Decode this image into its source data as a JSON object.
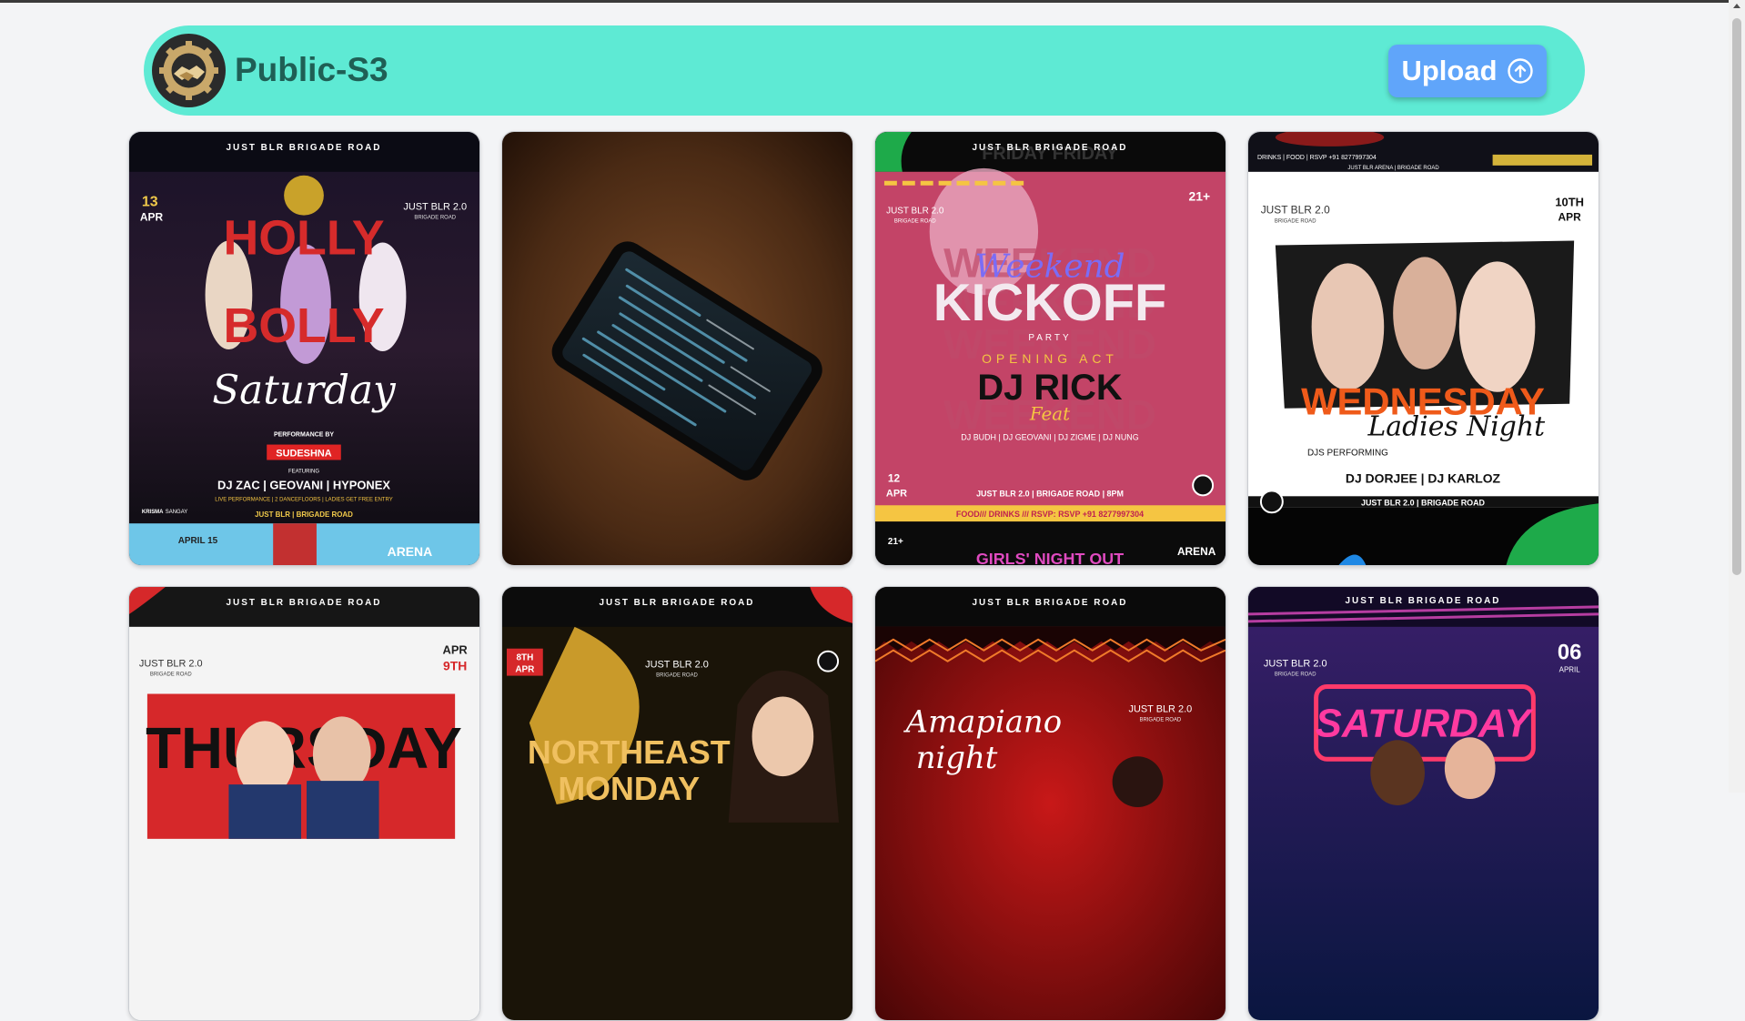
{
  "app": {
    "title": "Public-S3",
    "upload_label": "Upload"
  },
  "colors": {
    "header_bg": "#5eead4",
    "title": "#1f5f55",
    "upload_bg": "#60a5fa",
    "page_bg": "#f3f4f6"
  },
  "posters": [
    {
      "top": "JUST BLR BRIGADE ROAD",
      "date_day": "13",
      "date_month": "APR",
      "brand": "JUST BLR 2.0",
      "brand_sub": "BRIGADE ROAD",
      "line1": "HOLLY",
      "line2": "BOLLY",
      "script": "Saturday",
      "perf_by": "PERFORMANCE BY",
      "performer": "SUDESHNA",
      "featuring": "FEATURING",
      "djs": "DJ ZAC | GEOVANI | HYPONEX",
      "info": "LIVE PERFORMANCE | 2 DANCEFLOORS | LADIES GET FREE ENTRY",
      "footer": "JUST BLR | BRIGADE ROAD",
      "strip_a": "APRIL 15",
      "strip_b": "ARENA",
      "tag_left_a": "KRISMA",
      "tag_left_b": "SANGAY"
    },
    {
      "description": "phone-photo"
    },
    {
      "top": "JUST BLR BRIGADE ROAD",
      "top_bg": "FRIDAY FRIDAY",
      "brand": "JUST BLR 2.0",
      "brand_sub": "BRIGADE ROAD",
      "age": "21+",
      "script": "Weekend",
      "kick": "KICKOFF",
      "party": "PARTY",
      "opening": "OPENING ACT",
      "dj": "DJ RICK",
      "feat": "Feat",
      "djs": "DJ BUDH | DJ GEOVANI | DJ ZIGME | DJ NUNG",
      "date_day": "12",
      "date_month": "APR",
      "venue": "JUST BLR 2.0 | BRIGADE ROAD | 8PM",
      "rsvp": "FOOD/// DRINKS /// RSVP: RSVP +91 8277997304",
      "bottom_age": "21+",
      "bottom": "GIRLS' NIGHT OUT",
      "bottom_brand": "ARENA",
      "bg_word": "WEEKEND"
    },
    {
      "top_strip": "DRINKS | FOOD | RSVP +91 8277997304",
      "top_strip2": "JUST BLR ARENA | BRIGADE ROAD",
      "brand": "JUST BLR 2.0",
      "brand_sub": "BRIGADE ROAD",
      "date_day": "10TH",
      "date_month": "APR",
      "title": "WEDNESDAY",
      "script": "Ladies Night",
      "djs_label": "DJS PERFORMING",
      "djs": "DJ DORJEE | DJ KARLOZ",
      "footer": "JUST BLR 2.0 | BRIGADE ROAD"
    },
    {
      "top": "JUST BLR BRIGADE ROAD",
      "brand": "JUST BLR 2.0",
      "brand_sub": "BRIGADE ROAD",
      "date_month": "APR",
      "date_day": "9TH",
      "title": "THURSDAY"
    },
    {
      "top": "JUST BLR BRIGADE ROAD",
      "date_day": "8TH",
      "date_month": "APR",
      "brand": "JUST BLR 2.0",
      "brand_sub": "BRIGADE ROAD",
      "title": "NORTHEAST",
      "title2": "MONDAY"
    },
    {
      "top": "JUST BLR BRIGADE ROAD",
      "brand": "JUST BLR 2.0",
      "brand_sub": "BRIGADE ROAD",
      "script": "Amapiano",
      "script2": "night"
    },
    {
      "top": "JUST BLR BRIGADE ROAD",
      "brand": "JUST BLR 2.0",
      "brand_sub": "BRIGADE ROAD",
      "date_day": "06",
      "date_month": "APRIL",
      "title": "SATURDAY"
    }
  ]
}
